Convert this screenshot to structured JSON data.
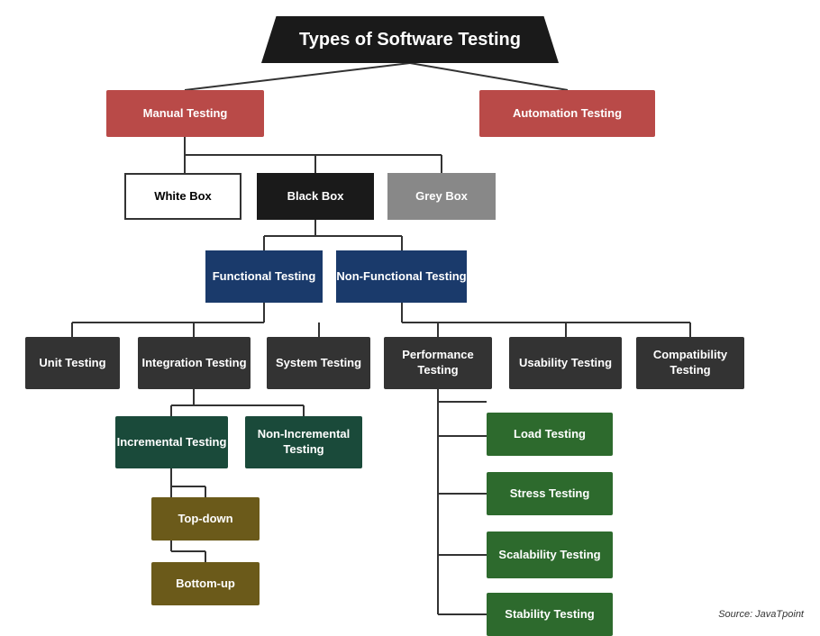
{
  "title": "Types of Software Testing",
  "nodes": {
    "manual": "Manual Testing",
    "automation": "Automation Testing",
    "whitebox": "White Box",
    "blackbox": "Black Box",
    "greybox": "Grey Box",
    "functional": "Functional Testing",
    "nonfunctional": "Non-Functional Testing",
    "unit": "Unit Testing",
    "integration": "Integration Testing",
    "system": "System Testing",
    "performance": "Performance Testing",
    "usability": "Usability Testing",
    "compatibility": "Compatibility Testing",
    "incremental": "Incremental Testing",
    "nonincremental": "Non-Incremental Testing",
    "topdown": "Top-down",
    "bottomup": "Bottom-up",
    "load": "Load Testing",
    "stress": "Stress Testing",
    "scalability": "Scalability Testing",
    "stability": "Stability Testing"
  },
  "source": "Source: JavaTpoint",
  "colors": {
    "title_bg": "#1a1a1a",
    "red": "#b94a48",
    "dark": "#333333",
    "teal": "#1a4a3a",
    "navy": "#1a3a6b",
    "olive": "#6b5a1a",
    "green": "#2d6a2d",
    "grey": "#888888",
    "white": "#ffffff"
  }
}
